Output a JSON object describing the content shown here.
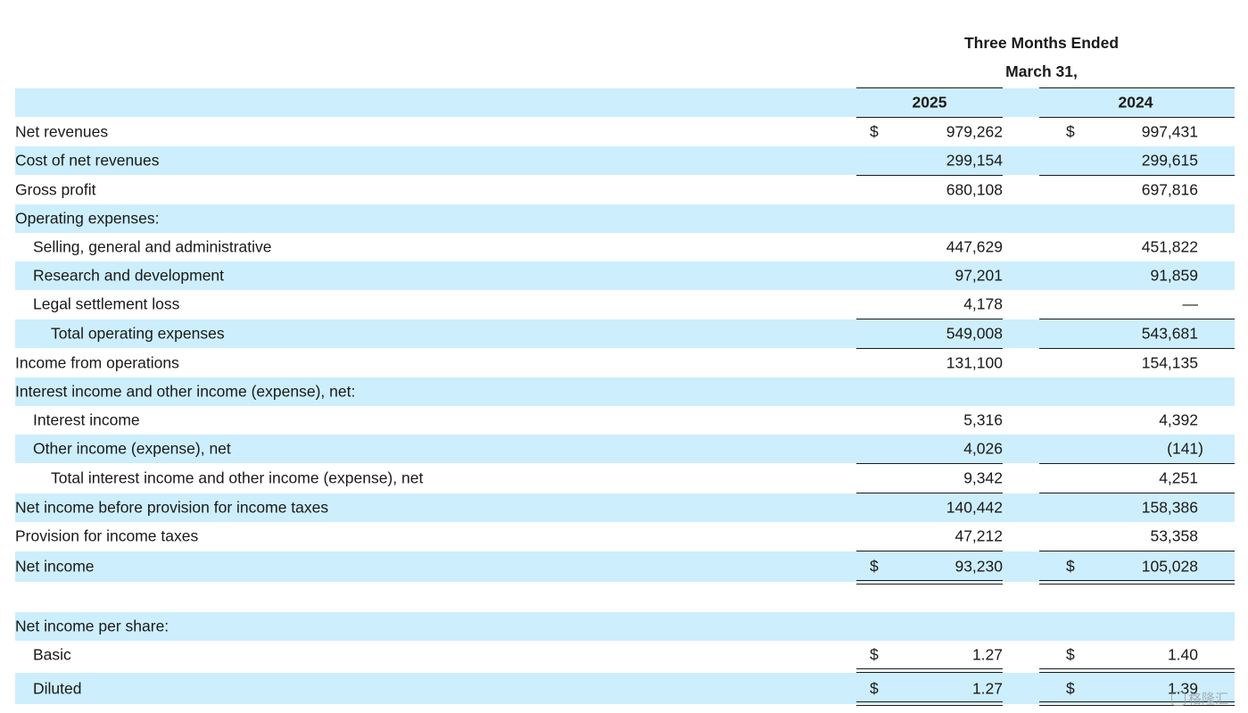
{
  "header": {
    "title_line1": "Three Months Ended",
    "title_line2": "March 31,",
    "year1": "2025",
    "year2": "2024"
  },
  "rows": [
    {
      "label": "Net revenues",
      "cur1": "$",
      "v1": "979,262",
      "cur2": "$",
      "v2": "997,431"
    },
    {
      "label": "Cost of net revenues",
      "v1": "299,154",
      "v2": "299,615"
    },
    {
      "label": "Gross profit",
      "v1": "680,108",
      "v2": "697,816"
    },
    {
      "label": "Operating expenses:"
    },
    {
      "label": "Selling, general and administrative",
      "v1": "447,629",
      "v2": "451,822"
    },
    {
      "label": "Research and development",
      "v1": "97,201",
      "v2": "91,859"
    },
    {
      "label": "Legal settlement loss",
      "v1": "4,178",
      "v2": "—"
    },
    {
      "label": "Total operating expenses",
      "v1": "549,008",
      "v2": "543,681"
    },
    {
      "label": "Income from operations",
      "v1": "131,100",
      "v2": "154,135"
    },
    {
      "label": "Interest income and other income (expense), net:"
    },
    {
      "label": "Interest income",
      "v1": "5,316",
      "v2": "4,392"
    },
    {
      "label": "Other income (expense), net",
      "v1": "4,026",
      "v2": "(141)"
    },
    {
      "label": "Total interest income and other income (expense), net",
      "v1": "9,342",
      "v2": "4,251"
    },
    {
      "label": "Net income before provision for income taxes",
      "v1": "140,442",
      "v2": "158,386"
    },
    {
      "label": "Provision for income taxes",
      "v1": "47,212",
      "v2": "53,358"
    },
    {
      "label": "Net income",
      "cur1": "$",
      "v1": "93,230",
      "cur2": "$",
      "v2": "105,028"
    },
    {
      "label": "Net income per share:"
    },
    {
      "label": "Basic",
      "cur1": "$",
      "v1": "1.27",
      "cur2": "$",
      "v2": "1.40"
    },
    {
      "label": "Diluted",
      "cur1": "$",
      "v1": "1.27",
      "cur2": "$",
      "v2": "1.39"
    }
  ],
  "watermark": {
    "text": "格隆汇"
  }
}
